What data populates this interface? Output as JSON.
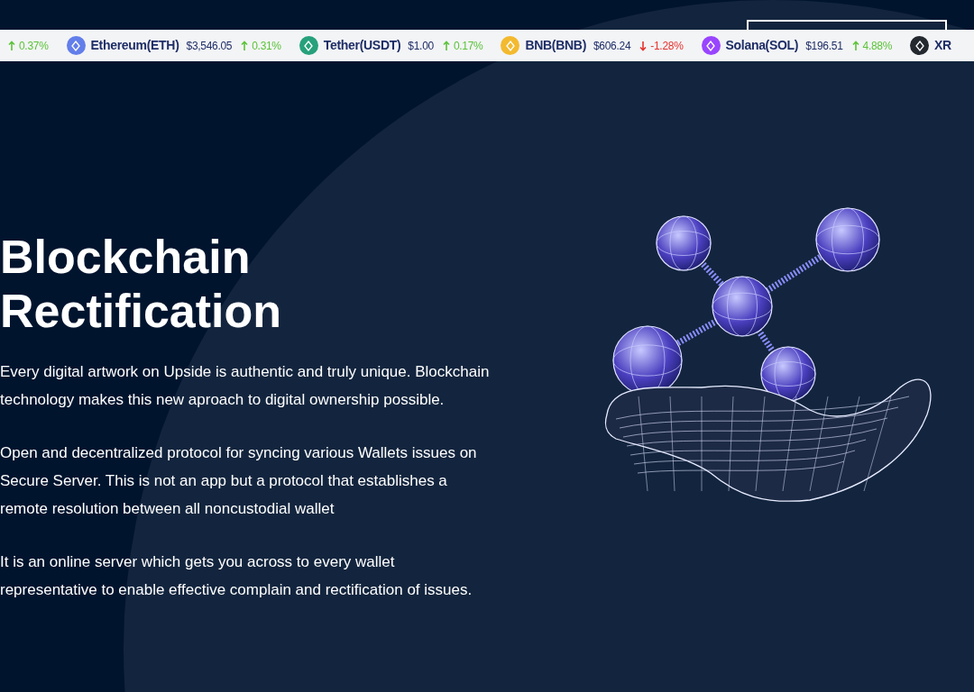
{
  "ticker": [
    {
      "change": "0.37%",
      "rising": true
    },
    {
      "name": "Ethereum(ETH)",
      "price": "$3,546.05",
      "change": "0.31%",
      "rising": true,
      "color": "#627eea"
    },
    {
      "name": "Tether(USDT)",
      "price": "$1.00",
      "change": "0.17%",
      "rising": true,
      "color": "#26a17b"
    },
    {
      "name": "BNB(BNB)",
      "price": "$606.24",
      "change": "-1.28%",
      "rising": false,
      "color": "#f3ba2f"
    },
    {
      "name": "Solana(SOL)",
      "price": "$196.51",
      "change": "4.88%",
      "rising": true,
      "color": "#9945ff"
    },
    {
      "name": "XR",
      "color": "#23292f"
    }
  ],
  "hero": {
    "title": "Blockchain Rectification",
    "paragraphs": [
      "Every digital artwork on Upside is authentic and truly unique. Blockchain technology makes this new aproach to digital ownership possible.",
      "Open and decentralized protocol for syncing various Wallets issues on Secure Server. This is not an app but a protocol that establishes a remote resolution between all noncustodial wallet",
      "It is an online server which gets you across to every wallet representative to enable effective complain and rectification of issues."
    ]
  }
}
